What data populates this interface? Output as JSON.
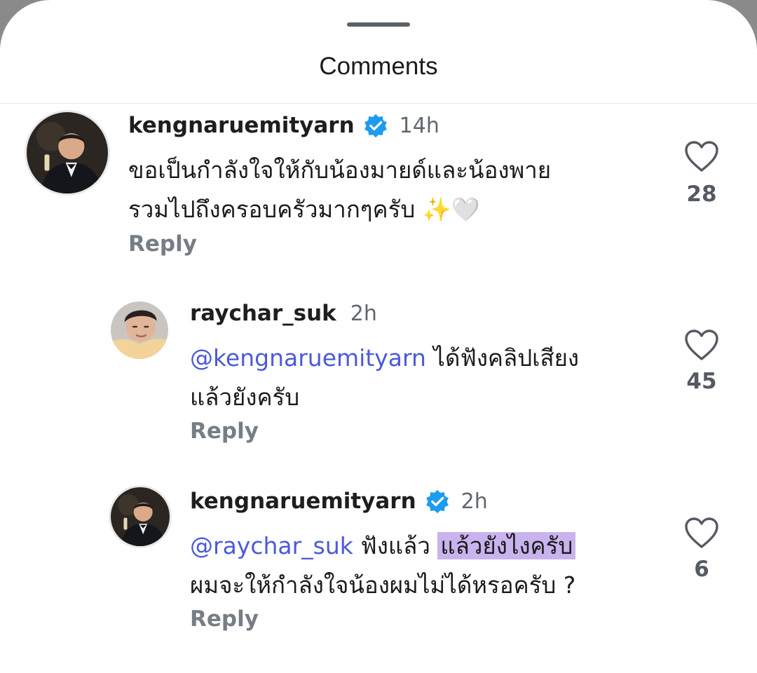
{
  "sheet": {
    "title": "Comments"
  },
  "comments": [
    {
      "username": "kengnaruemityarn",
      "time": "14h",
      "line1": "ขอเป็นกำลังใจให้กับน้องมายด์และน้องพาย",
      "line2": "รวมไปถึงครอบครัวมากๆครับ ✨🤍",
      "reply_label": "Reply",
      "like_count": "28"
    },
    {
      "username": "raychar_suk",
      "time": "2h",
      "mention": "@kengnaruemityarn",
      "line1_rest": " ได้ฟังคลิปเสียง",
      "line2": "แล้วยังครับ",
      "reply_label": "Reply",
      "like_count": "45"
    },
    {
      "username": "kengnaruemityarn",
      "time": "2h",
      "mention": "@raychar_suk",
      "line1_mid": " ฟังแล้ว ",
      "line1_highlight": "แล้วยังไงครับ",
      "line2": "ผมจะให้กำลังใจน้องผมไม่ได้หรอครับ ?",
      "reply_label": "Reply",
      "like_count": "6"
    }
  ],
  "colors": {
    "verified": "#1d9bf0",
    "mention": "#4c5ad8",
    "highlight": "#c9b3ee",
    "muted_text": "#777d86"
  },
  "icons": [
    "verified-badge-icon",
    "heart-icon"
  ]
}
